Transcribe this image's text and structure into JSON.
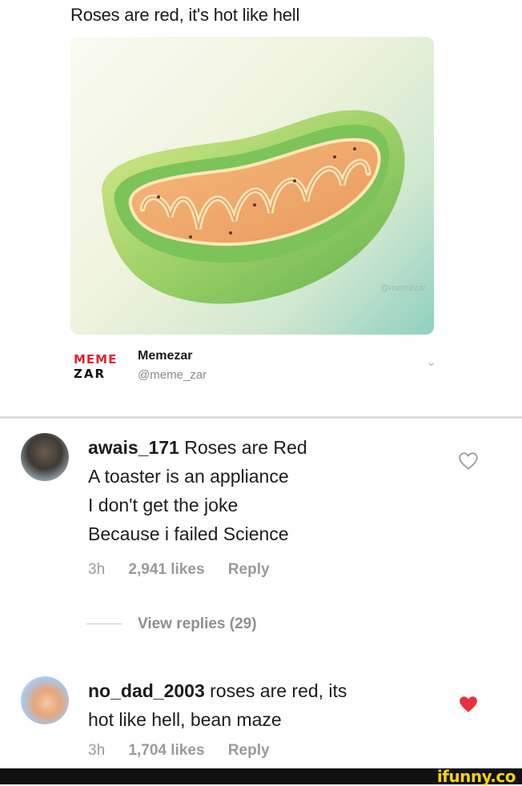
{
  "tweet": {
    "text": "Roses are red, it's hot like hell",
    "image_watermark": "@memezar",
    "account": {
      "logo_line1": "MEME",
      "logo_line2": "ZAR",
      "name": "Memezar",
      "handle": "@meme_zar"
    }
  },
  "comments": [
    {
      "username": "awais_171",
      "lines": [
        "Roses are Red",
        "A toaster is an appliance",
        "I don't get the joke",
        "Because i failed Science"
      ],
      "time": "3h",
      "likes": "2,941 likes",
      "reply_label": "Reply",
      "liked": false
    },
    {
      "username": "no_dad_2003",
      "lines": [
        "roses are red, its",
        "hot like hell, bean maze"
      ],
      "time": "3h",
      "likes": "1,704 likes",
      "reply_label": "Reply",
      "liked": true
    }
  ],
  "view_replies_label": "View replies (29)",
  "footer": {
    "brand": "ifunny.co"
  },
  "colors": {
    "heart_liked": "#e8303f",
    "heart_outline": "#9a9a9a",
    "brand_yellow": "#f5d20d",
    "logo_red": "#e0262f"
  },
  "icons": [
    "chevron-down-icon",
    "heart-outline-icon",
    "heart-filled-icon"
  ]
}
